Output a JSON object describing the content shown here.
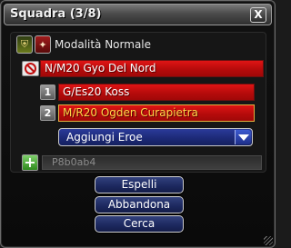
{
  "window": {
    "title": "Squadra (3/8)",
    "close_label": "X"
  },
  "mode": {
    "label": "Modalità Normale",
    "icons": [
      "mode-helmet-icon",
      "mode-shield-icon"
    ]
  },
  "party": {
    "leader": {
      "name": "N/M20 Gyo Del Nord",
      "icon": "leader-ban-icon"
    },
    "members": [
      {
        "slot": "1",
        "name": "G/Es20 Koss",
        "selected": false
      },
      {
        "slot": "2",
        "name": "M/R20 Ogden Curapietra",
        "selected": true
      }
    ]
  },
  "hero_dropdown": {
    "selected": "Aggiungi Eroe"
  },
  "add_player": {
    "button_label": "+",
    "value": "P8b0ab4"
  },
  "actions": {
    "kick": "Espelli",
    "leave": "Abbandona",
    "search": "Cerca"
  },
  "colors": {
    "member_bar": "#c81010",
    "selected_text": "#ffd84a",
    "dropdown_blue": "#1d2a78"
  }
}
